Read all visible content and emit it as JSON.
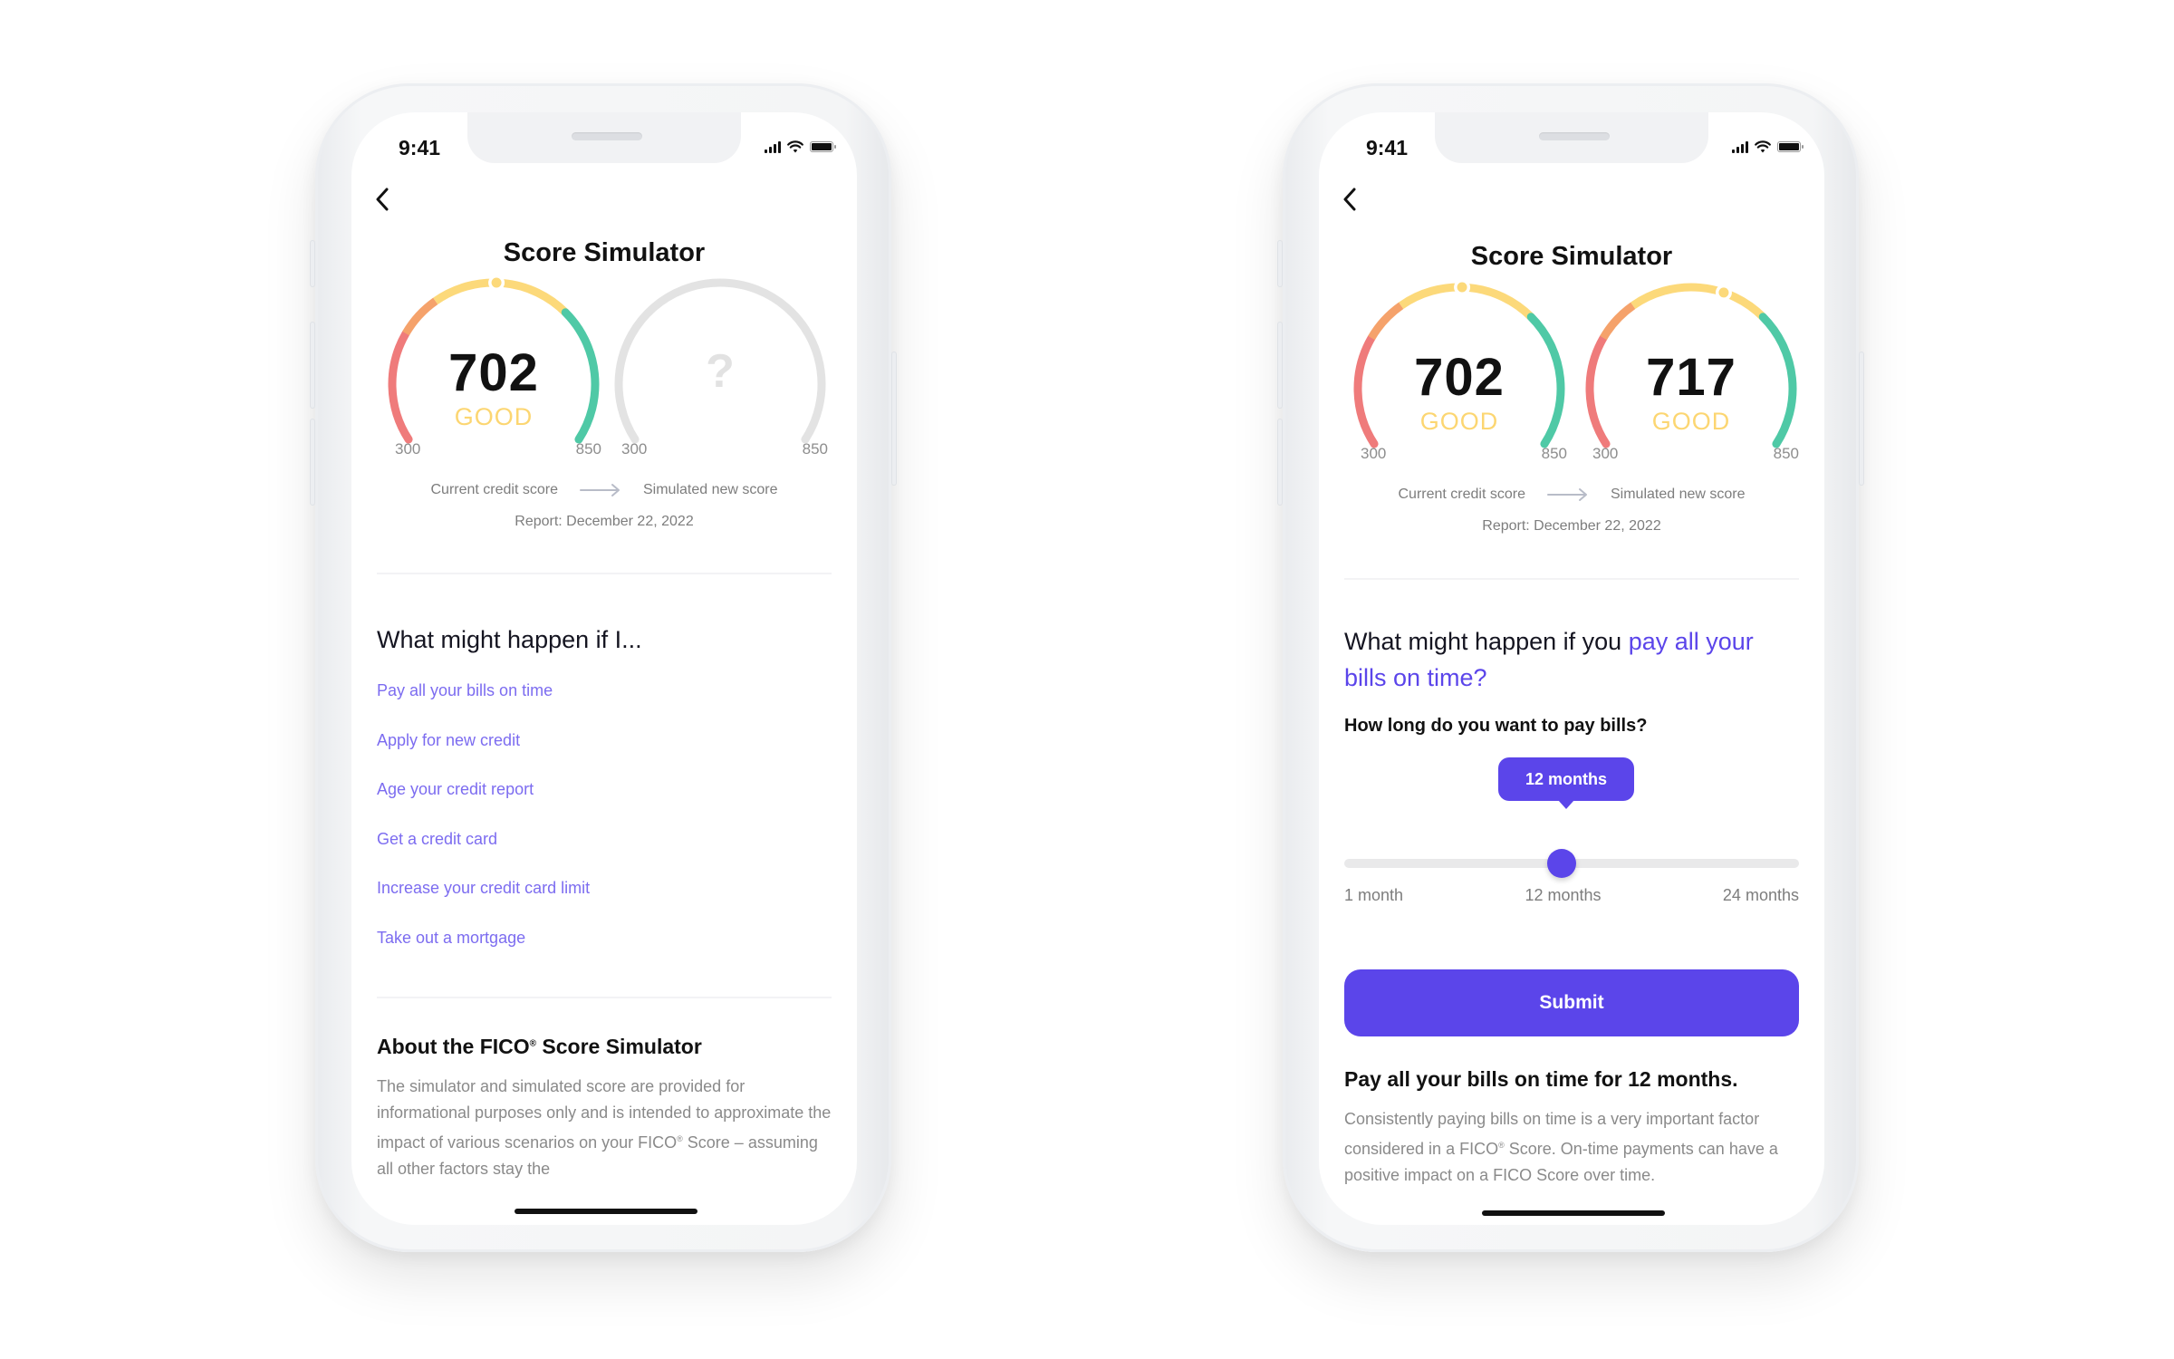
{
  "colors": {
    "accent": "#5B45EA",
    "link": "#7C6CF0",
    "gauge_red": "#EF7B7B",
    "gauge_orange": "#F5A26B",
    "gauge_yellow": "#FCD97A",
    "gauge_green": "#4FC9A6",
    "gauge_empty": "#E3E3E3",
    "rating_good": "#FCD672"
  },
  "gauge_scale": {
    "min": 300,
    "max": 850,
    "bands": [
      {
        "name": "poor",
        "from": 300,
        "to": 580,
        "color": "#EF7B7B"
      },
      {
        "name": "fair",
        "from": 580,
        "to": 670,
        "color": "#F5A26B"
      },
      {
        "name": "good",
        "from": 670,
        "to": 740,
        "color": "#FCD97A"
      },
      {
        "name": "very-good-exceptional",
        "from": 740,
        "to": 850,
        "color": "#4FC9A6"
      }
    ]
  },
  "left_phone": {
    "status": {
      "time": "9:41",
      "icons": [
        "signal-icon",
        "wifi-icon",
        "battery-icon"
      ]
    },
    "back_icon": "chevron-left-icon",
    "title": "Score Simulator",
    "current_gauge": {
      "score": 702,
      "score_text": "702",
      "rating": "GOOD",
      "min_label": "300",
      "max_label": "850"
    },
    "simulated_gauge": {
      "placeholder": "?",
      "min_label": "300",
      "max_label": "850"
    },
    "legend": {
      "current": "Current credit score",
      "arrow_icon": "arrow-right-icon",
      "simulated": "Simulated new score"
    },
    "report": "Report: December 22, 2022",
    "scenarios_heading": "What might happen if I...",
    "scenarios": [
      "Pay all your bills on time",
      "Apply for new credit",
      "Age your credit report",
      "Get a credit card",
      "Increase your credit card limit",
      "Take out a mortgage"
    ],
    "about": {
      "heading_pre": "About the FICO",
      "heading_reg": "®",
      "heading_post": " Score Simulator",
      "para_1": "The simulator and simulated score are provided for informational purposes only and is intended to approximate the impact of various scenarios on your FICO",
      "para_reg": "®",
      "para_2": " Score – assuming all other factors stay the"
    }
  },
  "right_phone": {
    "status": {
      "time": "9:41",
      "icons": [
        "signal-icon",
        "wifi-icon",
        "battery-icon"
      ]
    },
    "back_icon": "chevron-left-icon",
    "title": "Score Simulator",
    "current_gauge": {
      "score": 702,
      "score_text": "702",
      "rating": "GOOD",
      "min_label": "300",
      "max_label": "850"
    },
    "simulated_gauge": {
      "score": 717,
      "score_text": "717",
      "rating": "GOOD",
      "min_label": "300",
      "max_label": "850"
    },
    "legend": {
      "current": "Current credit score",
      "arrow_icon": "arrow-right-icon",
      "simulated": "Simulated new score"
    },
    "report": "Report: December 22, 2022",
    "heading_pre": "What might happen if you ",
    "heading_accent": "pay all your bills on time?",
    "question": "How long do you want to pay bills?",
    "slider": {
      "min": 1,
      "max": 24,
      "value": 12,
      "tooltip": "12 months",
      "labels": [
        "1 month",
        "12 months",
        "24 months"
      ]
    },
    "submit_label": "Submit",
    "result_heading": "Pay all your bills on time for 12 months.",
    "result_para_1": "Consistently paying bills on time is a very important factor considered in a FICO",
    "result_para_reg": "®",
    "result_para_2": " Score. On-time payments can have a positive impact on a FICO Score over time."
  }
}
